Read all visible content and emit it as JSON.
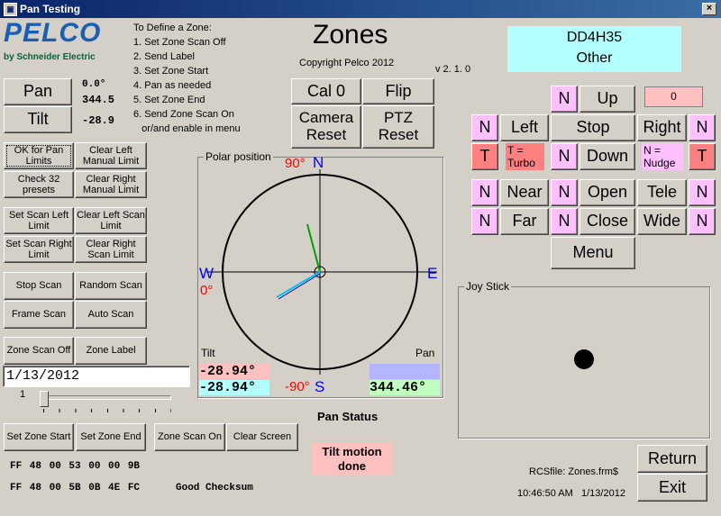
{
  "window": {
    "title": "Pan Testing",
    "close": "×"
  },
  "logo": {
    "brand": "PELCO",
    "sub": "by Schneider Electric"
  },
  "instructions": [
    "To Define a Zone:",
    "1. Set Zone Scan Off",
    "2. Send Label",
    "3. Set Zone Start",
    "4. Pan as needed",
    "5. Set Zone End",
    "6. Send Zone Scan On",
    "   or/and enable in menu"
  ],
  "header": {
    "title": "Zones",
    "copyright": "Copyright Pelco 2012",
    "version": "v 2. 1. 0"
  },
  "device": {
    "id": "DD4H35",
    "type": "Other"
  },
  "pan_tilt": {
    "pan_label": "Pan",
    "pan_value": "0.0°",
    "pan_value2": "344.5",
    "tilt_label": "Tilt",
    "tilt_value": "-28.9"
  },
  "top_buttons": {
    "cal0": "Cal 0",
    "flip": "Flip",
    "camera_reset": "Camera Reset",
    "ptz_reset": "PTZ Reset"
  },
  "left_buttons": {
    "ok_pan_limits": "OK for Pan Limits",
    "clear_left_manual": "Clear Left Manual Limit",
    "check_presets": "Check 32 presets",
    "clear_right_manual": "Clear Right Manual Limit",
    "set_scan_left": "Set Scan Left Limit",
    "clear_left_scan": "Clear Left Scan Limit",
    "set_scan_right": "Set Scan Right Limit",
    "clear_right_scan": "Clear Right Scan Limit",
    "stop_scan": "Stop Scan",
    "random_scan": "Random Scan",
    "frame_scan": "Frame Scan",
    "auto_scan": "Auto Scan",
    "zone_scan_off": "Zone Scan Off",
    "zone_label": "Zone Label"
  },
  "date_field": "1/13/2012",
  "slider": {
    "label": "1",
    "value": 0
  },
  "bottom_buttons": {
    "zone_start": "Set Zone Start",
    "zone_end": "Set Zone End",
    "zone_scan_on": "Zone Scan On",
    "clear_screen": "Clear Screen"
  },
  "hex": {
    "line1": "FF 48 00 53 00 00 9B",
    "line2": "FF 48 00 5B 0B 4E FC",
    "checksum": "Good Checksum"
  },
  "polar": {
    "caption": "Polar position",
    "n": "N",
    "s": "S",
    "e": "E",
    "w": "W",
    "deg_top": "90°",
    "deg_left": "0°",
    "deg_bottom": "-90°",
    "tilt_label": "Tilt",
    "pan_label": "Pan",
    "tilt_val1": "-28.94°",
    "tilt_val2": "-28.94°",
    "pan_val": "344.46°"
  },
  "pan_status": "Pan Status",
  "tilt_motion": "Tilt motion done",
  "ptz": {
    "counter": "0",
    "n": "N",
    "t": "T",
    "up": "Up",
    "left": "Left",
    "stop": "Stop",
    "right": "Right",
    "down": "Down",
    "turbo": "T = Turbo",
    "nudge": "N = Nudge",
    "near": "Near",
    "open": "Open",
    "tele": "Tele",
    "far": "Far",
    "close": "Close",
    "wide": "Wide",
    "menu": "Menu"
  },
  "joystick": {
    "caption": "Joy Stick"
  },
  "footer": {
    "rcsfile": "RCSfile: Zones.frm$",
    "time": "10:46:50 AM",
    "date": "1/13/2012",
    "return": "Return",
    "exit": "Exit"
  },
  "colors": {
    "pink": "#ffc0ff",
    "red": "#ff8080",
    "cyan": "#b3ffff",
    "blue_label": "#0000ff",
    "red_label": "#ff0000"
  }
}
